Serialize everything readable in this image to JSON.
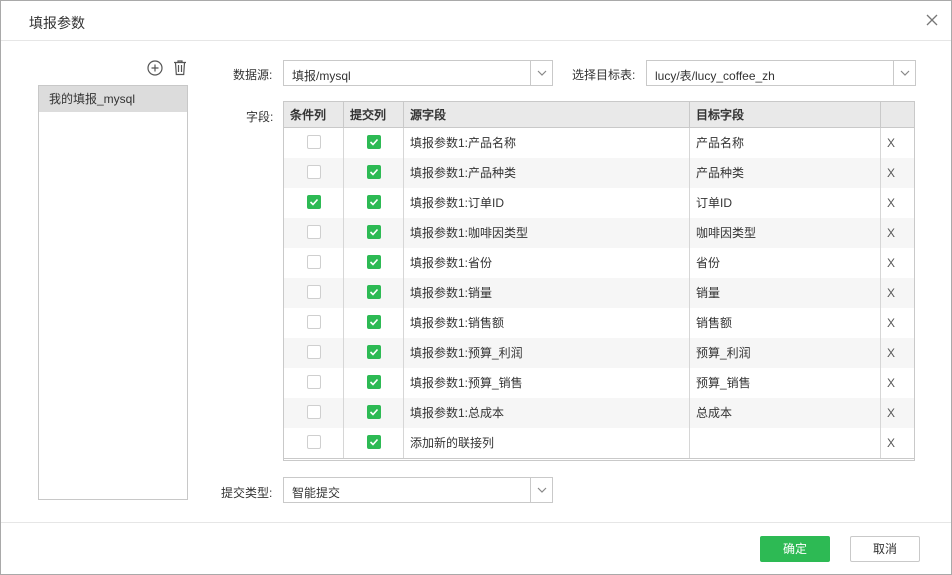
{
  "dialog": {
    "title": "填报参数",
    "close_icon": "close-icon"
  },
  "left": {
    "add_icon": "plus-circle-icon",
    "delete_icon": "trash-icon",
    "items": [
      {
        "label": "我的填报_mysql",
        "selected": true
      }
    ]
  },
  "form": {
    "datasource_label": "数据源:",
    "datasource_value": "填报/mysql",
    "target_label": "选择目标表:",
    "target_value": "lucy/表/lucy_coffee_zh",
    "fields_label": "字段:",
    "submit_type_label": "提交类型:",
    "submit_type_value": "智能提交"
  },
  "table": {
    "headers": [
      "条件列",
      "提交列",
      "源字段",
      "目标字段",
      ""
    ],
    "rows": [
      {
        "cond": false,
        "submit": true,
        "source": "填报参数1:产品名称",
        "target": "产品名称",
        "del": "X"
      },
      {
        "cond": false,
        "submit": true,
        "source": "填报参数1:产品种类",
        "target": "产品种类",
        "del": "X"
      },
      {
        "cond": true,
        "submit": true,
        "source": "填报参数1:订单ID",
        "target": "订单ID",
        "del": "X"
      },
      {
        "cond": false,
        "submit": true,
        "source": "填报参数1:咖啡因类型",
        "target": "咖啡因类型",
        "del": "X"
      },
      {
        "cond": false,
        "submit": true,
        "source": "填报参数1:省份",
        "target": "省份",
        "del": "X"
      },
      {
        "cond": false,
        "submit": true,
        "source": "填报参数1:销量",
        "target": "销量",
        "del": "X"
      },
      {
        "cond": false,
        "submit": true,
        "source": "填报参数1:销售额",
        "target": "销售额",
        "del": "X"
      },
      {
        "cond": false,
        "submit": true,
        "source": "填报参数1:预算_利润",
        "target": "预算_利润",
        "del": "X"
      },
      {
        "cond": false,
        "submit": true,
        "source": "填报参数1:预算_销售",
        "target": "预算_销售",
        "del": "X"
      },
      {
        "cond": false,
        "submit": true,
        "source": "填报参数1:总成本",
        "target": "总成本",
        "del": "X"
      },
      {
        "cond": false,
        "submit": true,
        "source": "添加新的联接列",
        "target": "",
        "del": "X"
      }
    ]
  },
  "buttons": {
    "ok": "确定",
    "cancel": "取消"
  },
  "colors": {
    "accent": "#2dba54",
    "header_bg": "#e9e9e9",
    "selected_item_bg": "#dcdcdc"
  }
}
